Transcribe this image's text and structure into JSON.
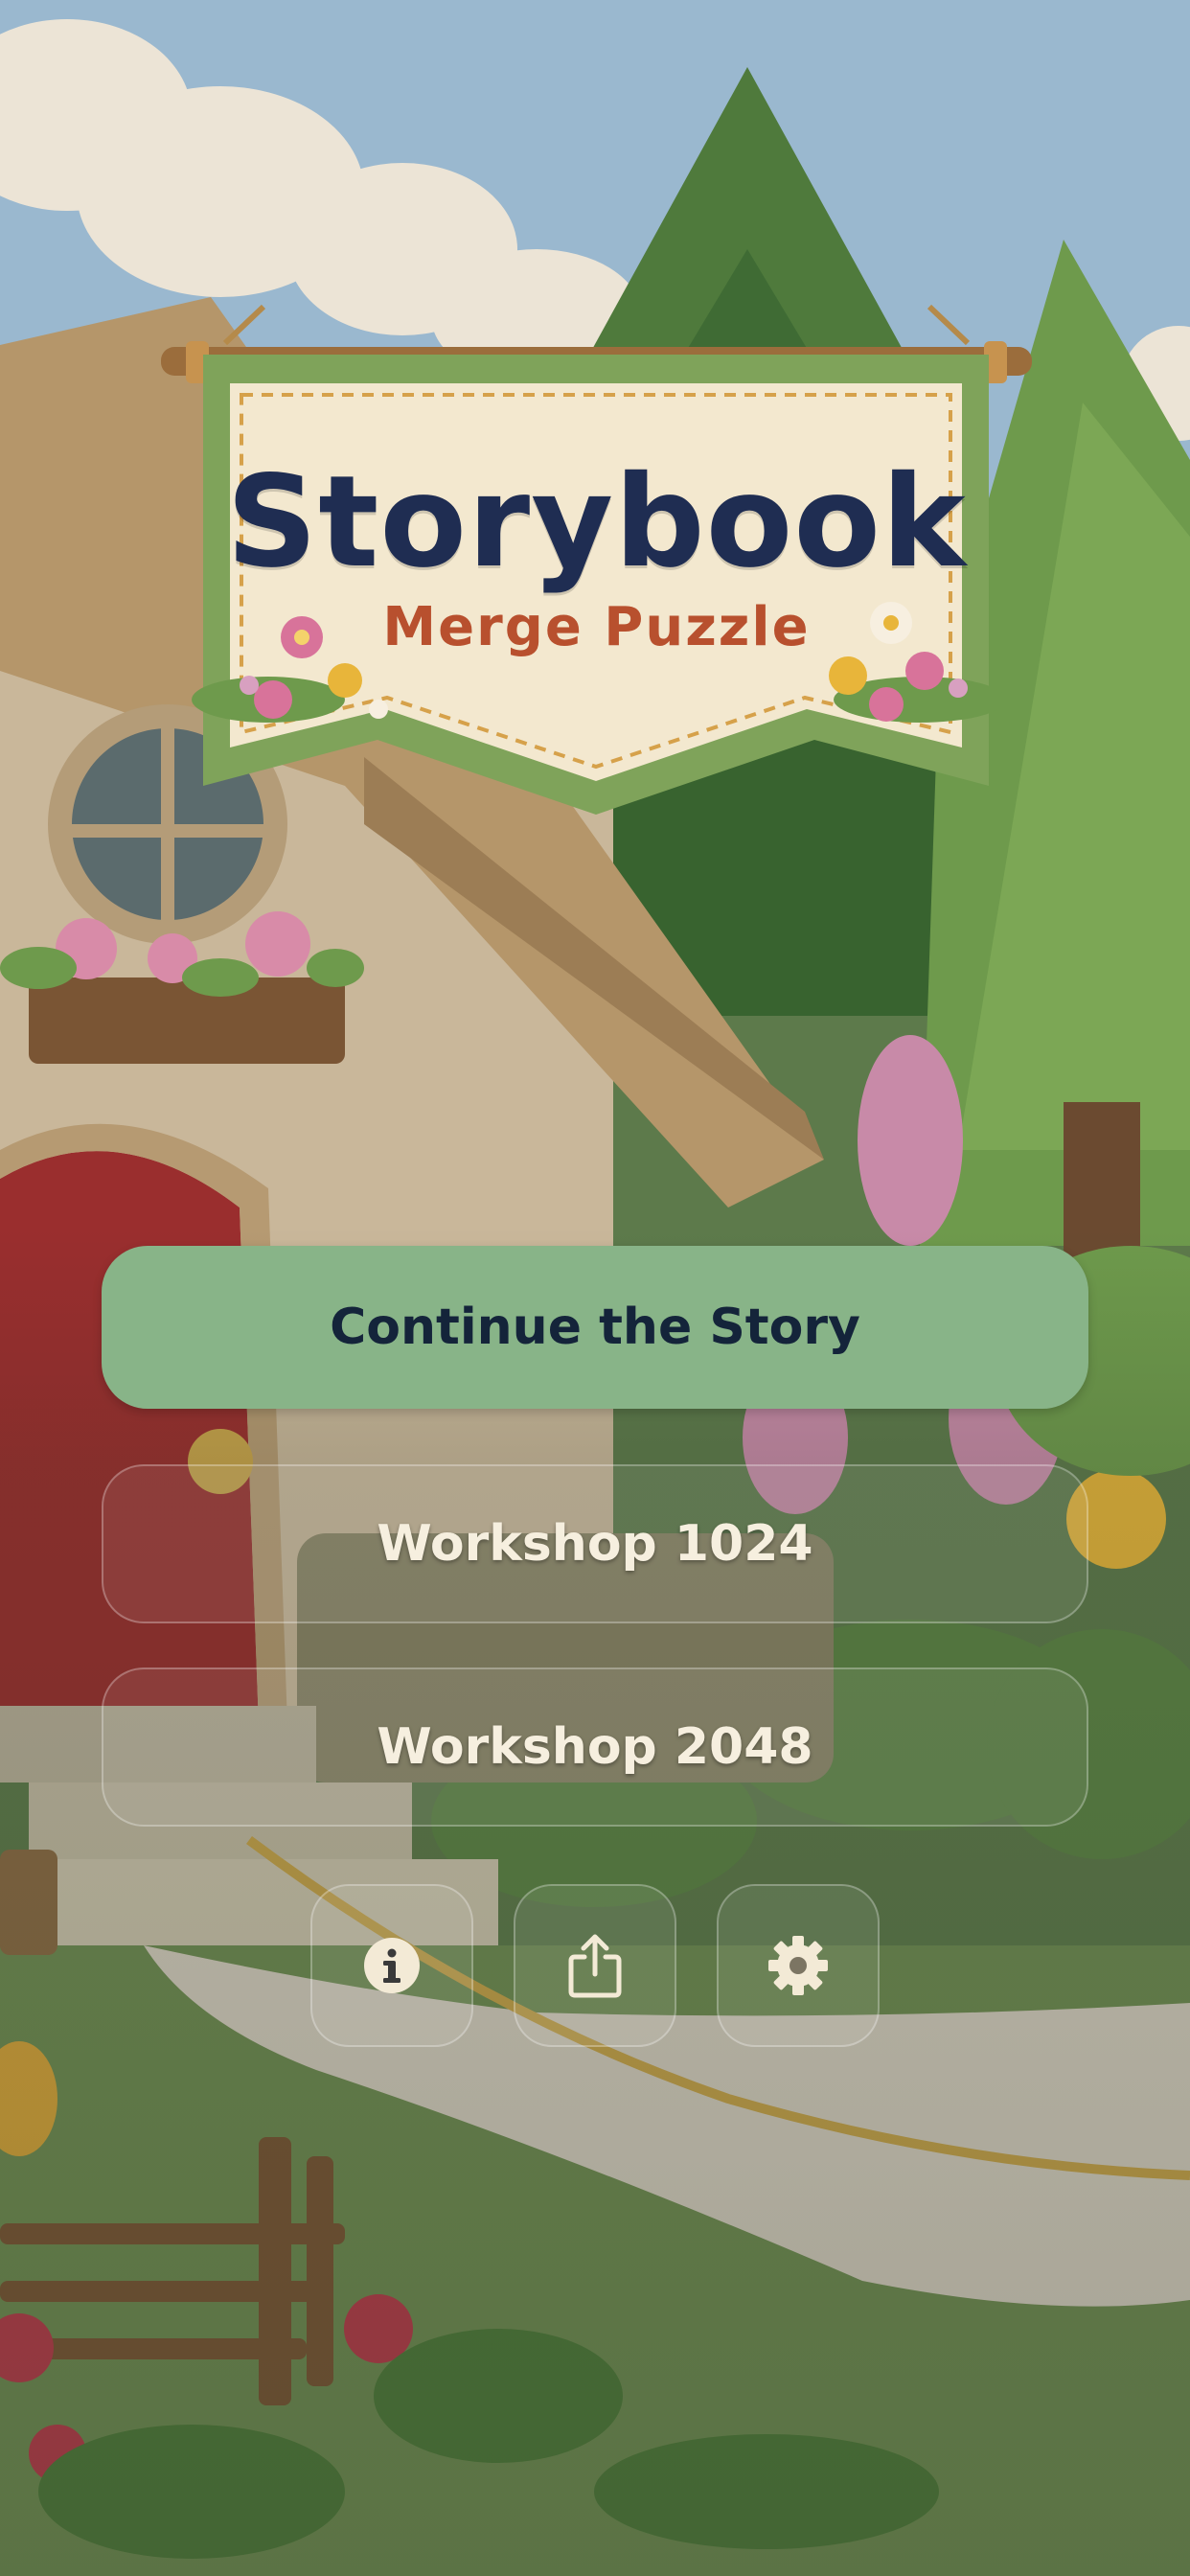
{
  "banner": {
    "title": "Storybook",
    "subtitle": "Merge Puzzle"
  },
  "menu": {
    "continue_label": "Continue the Story",
    "workshop_1024_label": "Workshop 1024",
    "workshop_2048_label": "Workshop 2048"
  },
  "toolbar": {
    "info_icon": "info-icon",
    "share_icon": "share-icon",
    "settings_icon": "gear-icon"
  },
  "colors": {
    "primary_button": "#88b488",
    "primary_text": "#14243a",
    "title_text": "#1f2d52",
    "subtitle_text": "#b8502e",
    "banner_border": "#7fa35a",
    "banner_fill": "#f3e8cf"
  }
}
